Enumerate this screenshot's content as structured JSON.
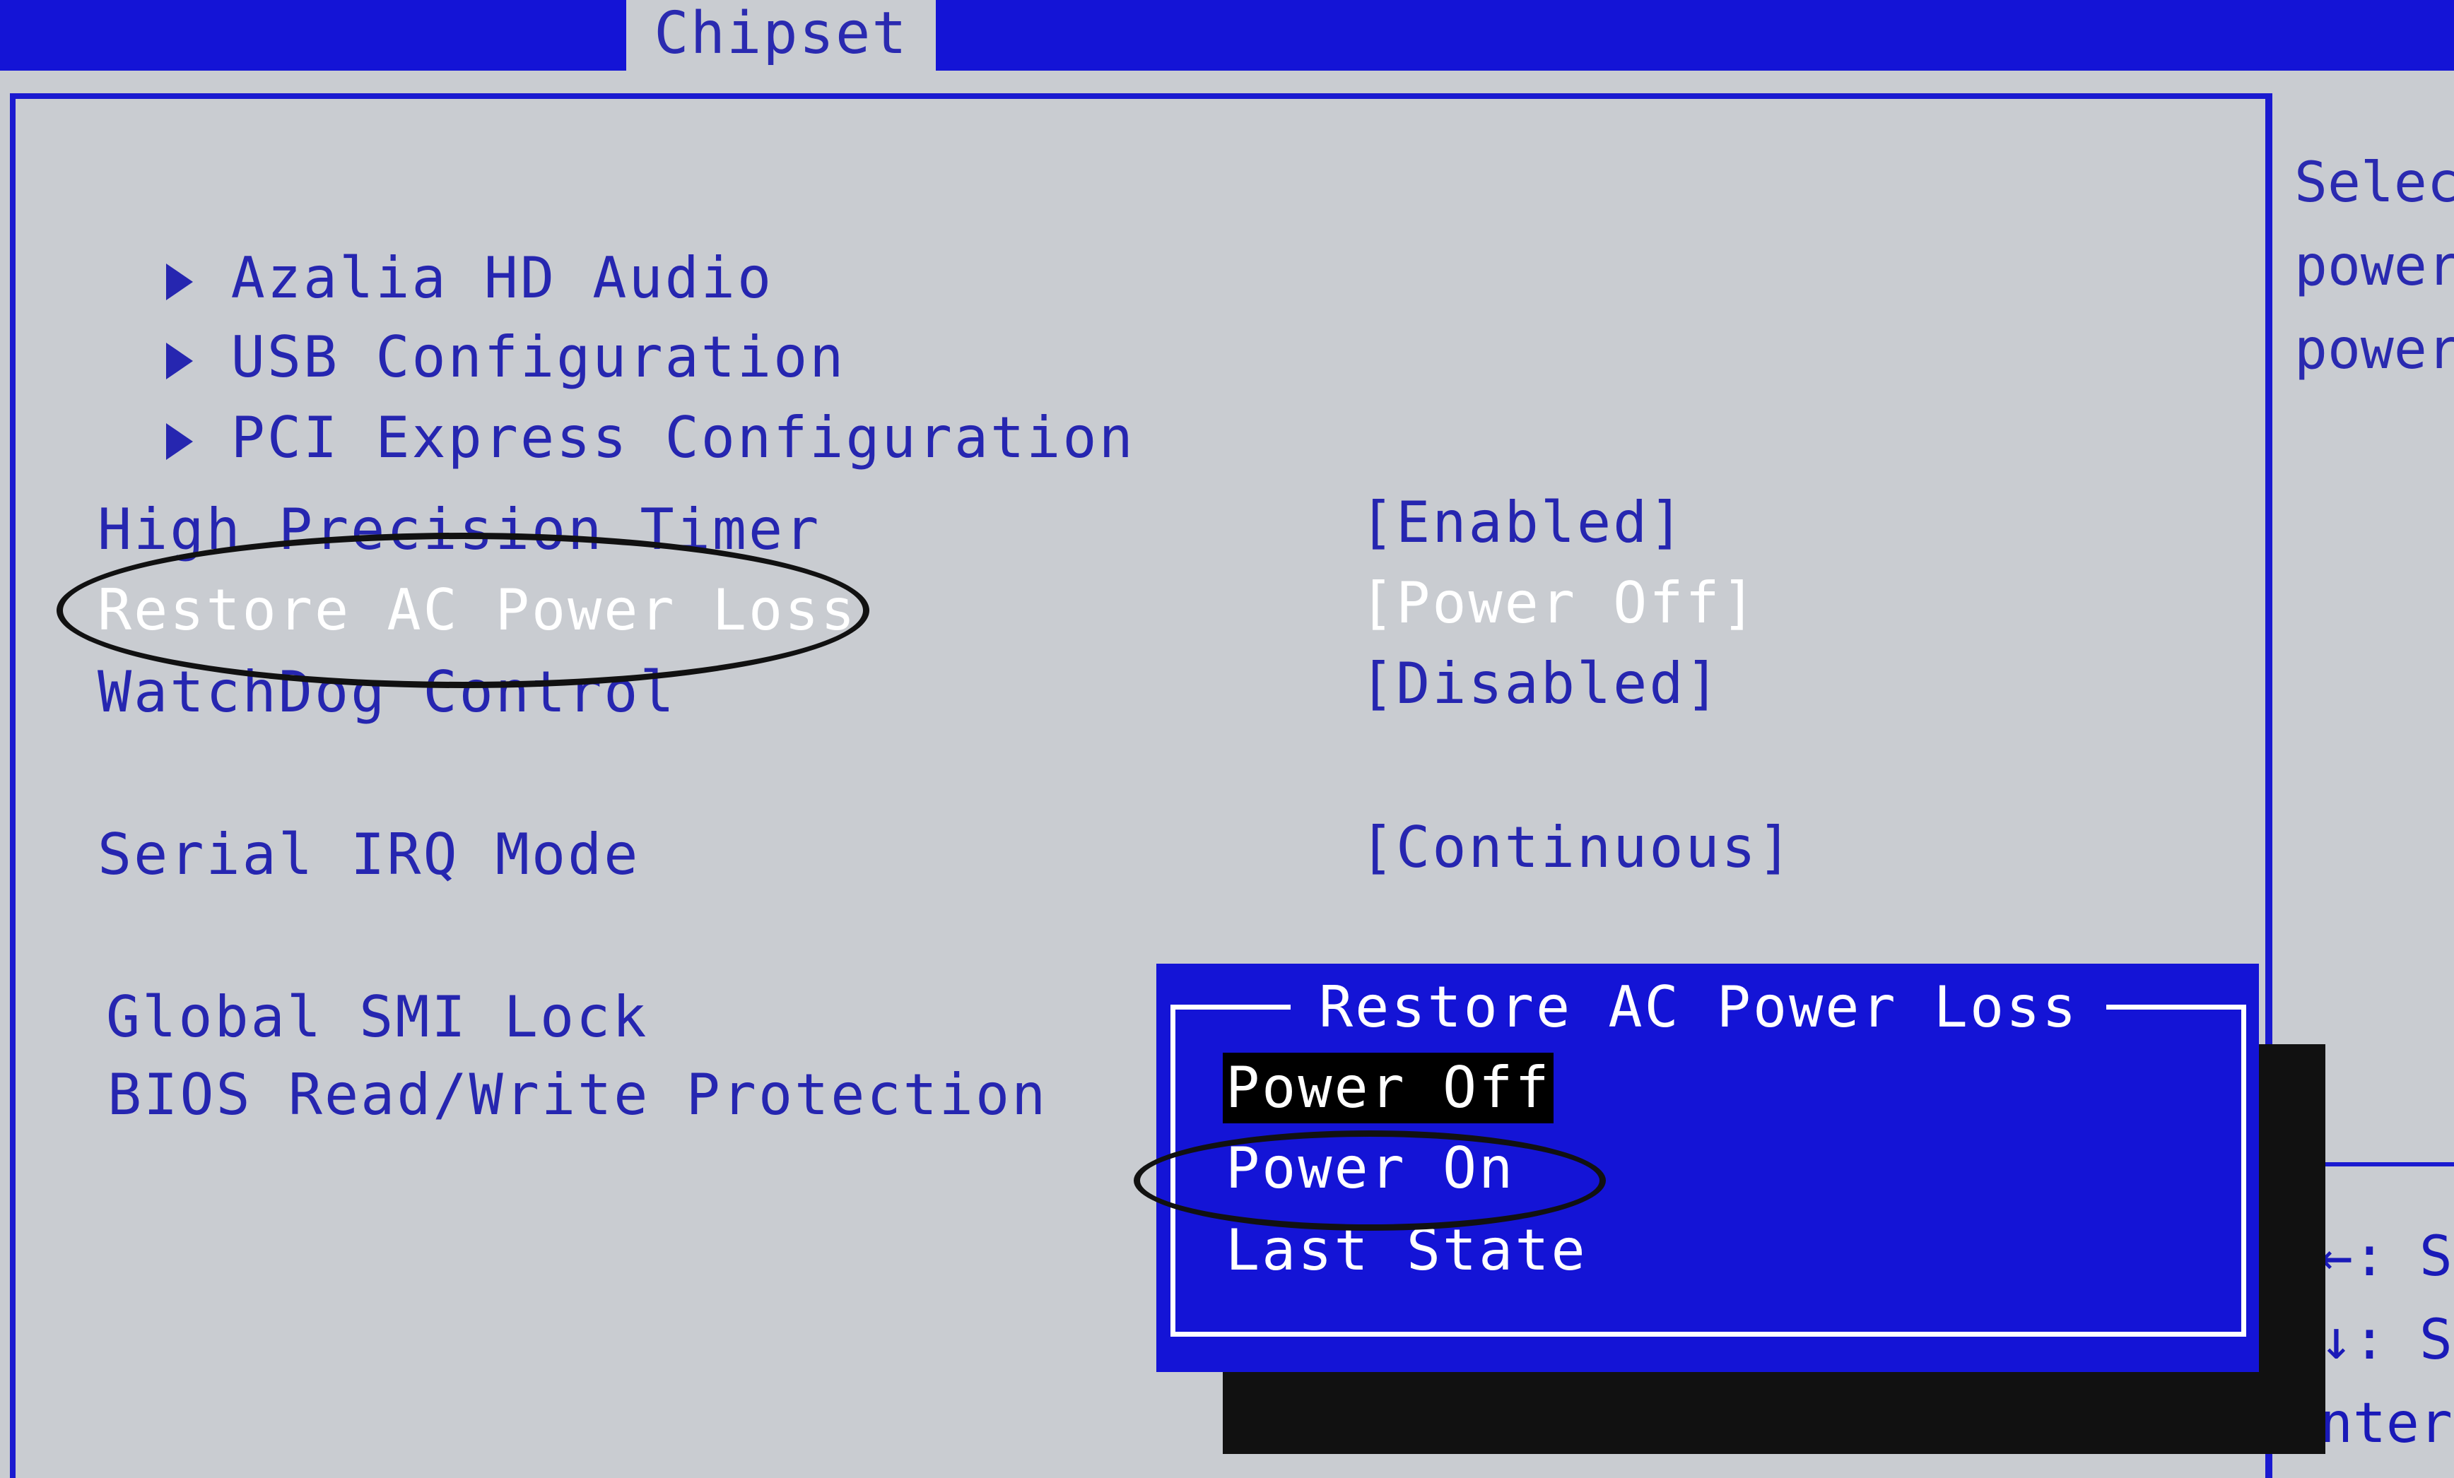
{
  "header": {
    "active_tab": "Chipset"
  },
  "submenus": [
    {
      "label": "Azalia HD Audio"
    },
    {
      "label": "USB Configuration"
    },
    {
      "label": "PCI Express Configuration"
    }
  ],
  "settings": [
    {
      "label": "High Precision Timer",
      "value": "[Enabled]"
    },
    {
      "label": "Restore AC Power Loss",
      "value": "[Power Off]"
    },
    {
      "label": "WatchDog Control",
      "value": "[Disabled]"
    },
    {
      "label": "Serial IRQ Mode",
      "value": "[Continuous]"
    },
    {
      "label": "Global SMI Lock",
      "value": ""
    },
    {
      "label": "BIOS Read/Write Protection",
      "value": ""
    }
  ],
  "help": {
    "text": "Selec\npower\npower",
    "keys": "←: S\n↓: S\nnter"
  },
  "popup": {
    "title": "Restore AC Power Loss",
    "options": [
      "Power Off",
      "Power On",
      "Last State"
    ],
    "highlighted": "Power Off"
  },
  "colors": {
    "bios_blue": "#1414d6",
    "background": "#c9ccd1",
    "text_blue": "#2626b0",
    "selected_text": "#ffffff"
  }
}
